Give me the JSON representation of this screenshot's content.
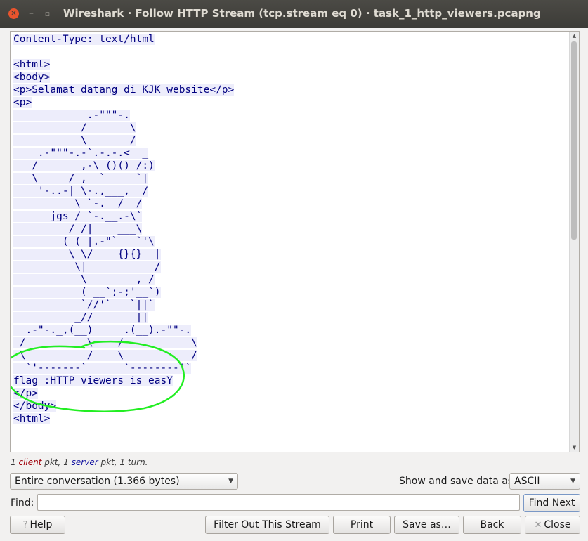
{
  "window": {
    "title": "Wireshark · Follow HTTP Stream (tcp.stream eq 0) · task_1_http_viewers.pcapng"
  },
  "stream": {
    "lines": [
      "Content-Type: text/html",
      "",
      "<html>",
      "<body>",
      "<p>Selamat datang di KJK website</p>",
      "<p>",
      "            .-\"\"\"-.",
      "           /       \\",
      "           \\       /",
      "    .-\"\"\"-.-`.-.-.<  _",
      "   /      _,-\\ ()()_/:)",
      "   \\     / ,  `     `|",
      "    '-..-| \\-.,___,  /",
      "          \\ `-.__/  /",
      "      jgs / `-.__.-\\`",
      "         / /|    ___\\",
      "        ( ( |.-\"`   `'\\",
      "         \\ \\/    {}{}  |",
      "          \\|           /",
      "           \\        , /",
      "           ( __`;-;'__`)",
      "           `//'`   `||`",
      "          _//       ||",
      "  .-\"-._,(__)     .(__).-\"\"-.",
      " /          \\    /           \\",
      " \\          /    \\           /",
      "  `'-------`      `--------'`",
      "flag :HTTP_viewers_is_easY",
      "</p>",
      "</body>",
      "<html>"
    ]
  },
  "status": {
    "client_count": "1",
    "client_word": "client",
    "pkt_sep": "pkt,",
    "server_count": "1",
    "server_word": "server",
    "tail": "pkt, 1 turn."
  },
  "conversation_select": {
    "value": "Entire conversation (1.366 bytes)"
  },
  "save_as": {
    "label": "Show and save data as",
    "value": "ASCII"
  },
  "find": {
    "label": "Find:",
    "value": "",
    "next_button": "Find Next"
  },
  "buttons": {
    "help": "Help",
    "filter_out": "Filter Out This Stream",
    "print": "Print",
    "save_as": "Save as…",
    "back": "Back",
    "close": "Close"
  },
  "colors": {
    "stream_text": "#000080",
    "stream_highlight": "#ededfb",
    "annotation": "#22ee22",
    "client": "#a0000a",
    "server": "#1010a0"
  }
}
